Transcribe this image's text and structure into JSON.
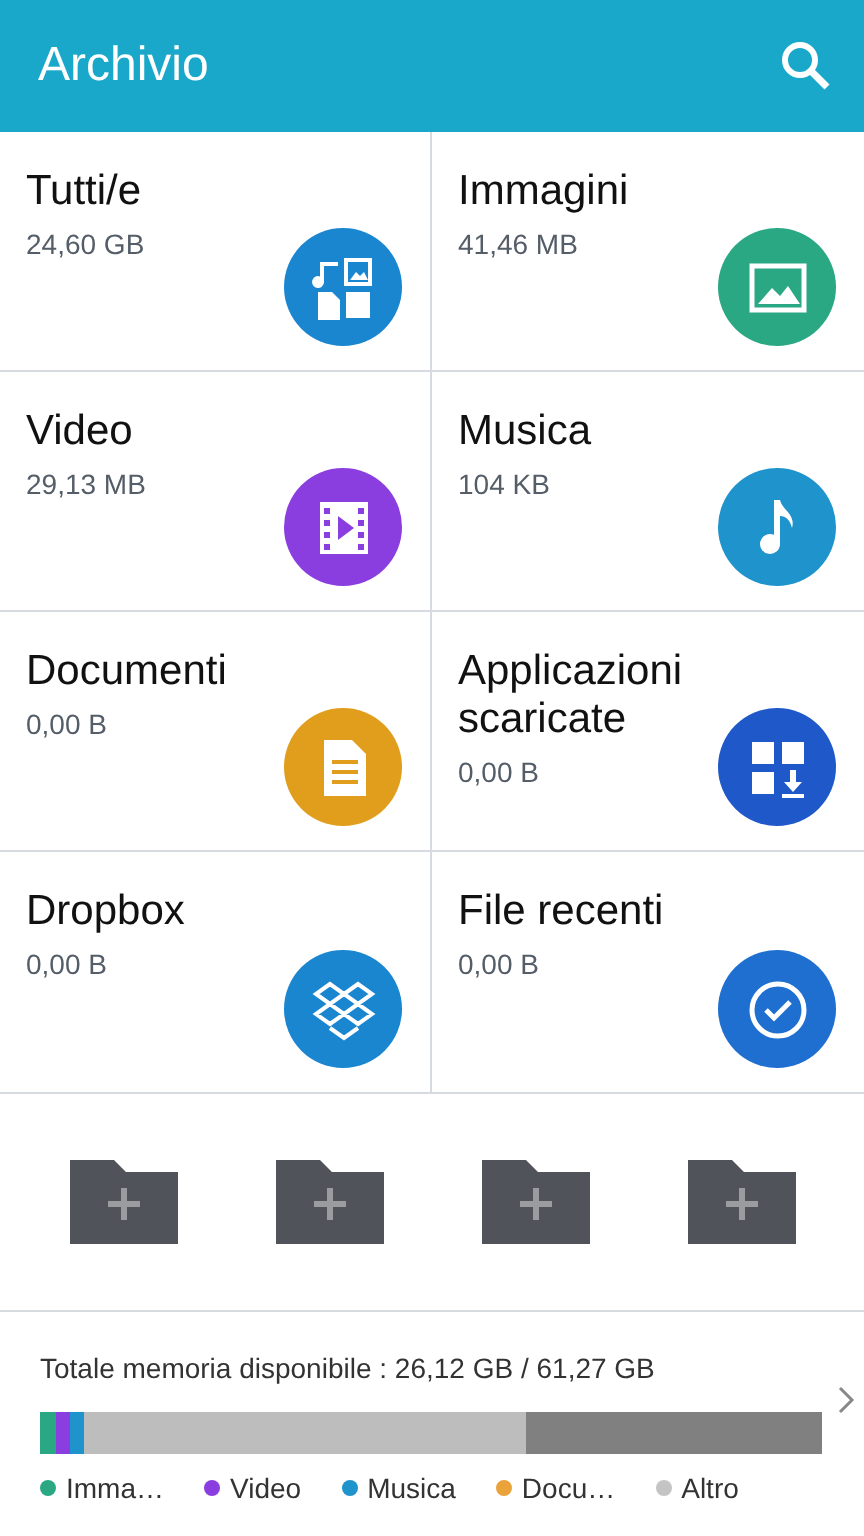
{
  "header": {
    "title": "Archivio"
  },
  "categories": [
    {
      "name": "Tutti/e",
      "size": "24,60 GB",
      "kind": "all",
      "color": "#1a86d0"
    },
    {
      "name": "Immagini",
      "size": "41,46 MB",
      "kind": "images",
      "color": "#2aa884"
    },
    {
      "name": "Video",
      "size": "29,13 MB",
      "kind": "video",
      "color": "#8b3ee0"
    },
    {
      "name": "Musica",
      "size": "104 KB",
      "kind": "music",
      "color": "#1f93cc"
    },
    {
      "name": "Documenti",
      "size": "0,00 B",
      "kind": "docs",
      "color": "#e09e1c"
    },
    {
      "name": "Applicazioni scaricate",
      "size": "0,00 B",
      "kind": "apps",
      "color": "#1f58c8"
    },
    {
      "name": "Dropbox",
      "size": "0,00 B",
      "kind": "dropbox",
      "color": "#1a86d0"
    },
    {
      "name": "File recenti",
      "size": "0,00 B",
      "kind": "recent",
      "color": "#1f6fd0"
    }
  ],
  "shortcuts": [
    {
      "kind": "add-folder"
    },
    {
      "kind": "add-folder"
    },
    {
      "kind": "add-folder"
    },
    {
      "kind": "add-folder"
    }
  ],
  "storage": {
    "summary": "Totale memoria disponibile : 26,12 GB / 61,27 GB",
    "segments": [
      {
        "color": "#2aa884"
      },
      {
        "color": "#8b3ee0"
      },
      {
        "color": "#1f93cc"
      },
      {
        "color": "#bdbdbd"
      }
    ],
    "legend": [
      {
        "label": "Imma…",
        "color": "#2aa884"
      },
      {
        "label": "Video",
        "color": "#8b3ee0"
      },
      {
        "label": "Musica",
        "color": "#1f93cc"
      },
      {
        "label": "Docu…",
        "color": "#e9a33a"
      },
      {
        "label": "Altro",
        "color": "#c4c4c4"
      }
    ]
  }
}
